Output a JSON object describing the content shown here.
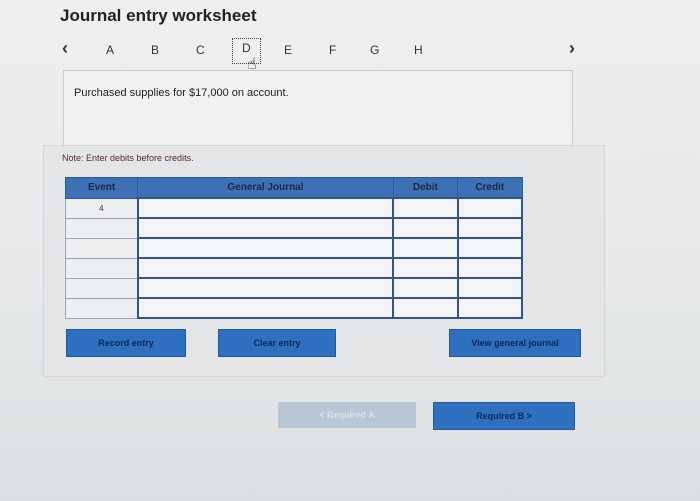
{
  "header": {
    "title": "Journal entry worksheet"
  },
  "nav": {
    "prev_icon": "chevron-left-icon",
    "next_icon": "chevron-right-icon",
    "tabs": [
      "A",
      "B",
      "C",
      "D",
      "E",
      "F",
      "G",
      "H"
    ],
    "active_tab": "D"
  },
  "question": {
    "text": "Purchased supplies for $17,000 on account."
  },
  "note": "Note: Enter debits before credits.",
  "table": {
    "headers": {
      "event": "Event",
      "general_journal": "General Journal",
      "debit": "Debit",
      "credit": "Credit"
    },
    "rows": [
      {
        "event": "4",
        "account": "",
        "debit": "",
        "credit": ""
      },
      {
        "event": "",
        "account": "",
        "debit": "",
        "credit": ""
      },
      {
        "event": "",
        "account": "",
        "debit": "",
        "credit": ""
      },
      {
        "event": "",
        "account": "",
        "debit": "",
        "credit": ""
      },
      {
        "event": "",
        "account": "",
        "debit": "",
        "credit": ""
      },
      {
        "event": "",
        "account": "",
        "debit": "",
        "credit": ""
      }
    ]
  },
  "buttons": {
    "record": "Record entry",
    "clear": "Clear entry",
    "view": "View general journal",
    "prev": "< Required A",
    "next": "Required B  >"
  },
  "colors": {
    "header_blue": "#3e70b5",
    "button_blue": "#2f6fc0",
    "disabled_button": "#b9c6d6"
  }
}
